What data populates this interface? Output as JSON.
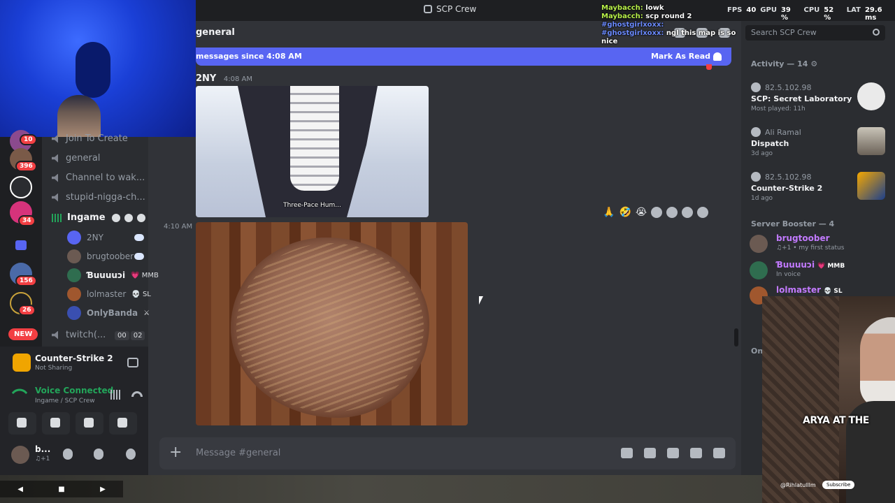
{
  "window": {
    "title": "SCP Crew"
  },
  "perf": {
    "fps_label": "FPS",
    "fps": "40",
    "gpu_label": "GPU",
    "gpu": "39 %",
    "cpu_label": "CPU",
    "cpu": "52 %",
    "lat_label": "LAT",
    "lat": "29.6 ms"
  },
  "server_rail": {
    "badges": [
      "10",
      "396",
      "34",
      "156",
      "26"
    ],
    "new_label": "NEW"
  },
  "channels": {
    "items": [
      "Join To Create",
      "general",
      "Channel to wak...",
      "stupid-nigga-ch...",
      "Ingame",
      "twitch(..."
    ],
    "voice_users": [
      {
        "name": "2NY",
        "tag": ""
      },
      {
        "name": "brugtoober",
        "tag": ""
      },
      {
        "name": "Ɓuuuuɔi",
        "tag": "💗 MMB"
      },
      {
        "name": "lolmaster",
        "tag": "💀 SL"
      },
      {
        "name": "OnlyBanda",
        "tag": "⚔"
      }
    ],
    "twitch_counts": [
      "00",
      "02"
    ]
  },
  "activity": {
    "game": "Counter-Strike 2",
    "status": "Not Sharing"
  },
  "voice": {
    "status": "Voice Connected",
    "location": "Ingame / SCP Crew"
  },
  "user": {
    "name": "b...",
    "status": "♫+1"
  },
  "chat": {
    "channel_title": "general",
    "new_messages": "messages since 4:08 AM",
    "mark_as_read": "Mark As Read",
    "new_tag": "NEW",
    "author": "2NY",
    "time1": "4:08 AM",
    "image1_caption": "Three-Pace Hum...",
    "time2": "4:10 AM",
    "reactions": [
      "🙏",
      "🤣",
      "😭"
    ],
    "composer_placeholder": "Message #general"
  },
  "overlay_chat": [
    {
      "user": "Maybacch:",
      "text": "lowk",
      "color": "green"
    },
    {
      "user": "Maybacch:",
      "text": "scp round 2",
      "color": "green"
    },
    {
      "user": "#ghostgirlxoxx:",
      "text": "",
      "color": "blue"
    },
    {
      "user": "#ghostgirlxoxx:",
      "text": "ngl this map is so nice",
      "color": "blue"
    }
  ],
  "sidebar": {
    "search_placeholder": "Search SCP Crew",
    "activity_header": "Activity — 14",
    "cards": [
      {
        "top": "82.5.102.98",
        "game": "SCP: Secret Laboratory",
        "ago": "Most played: 11h"
      },
      {
        "top": "Ali Ramal",
        "game": "Dispatch",
        "ago": "3d ago"
      },
      {
        "top": "82.5.102.98",
        "game": "Counter-Strike 2",
        "ago": "1d ago"
      }
    ],
    "booster_header": "Server Booster — 4",
    "members": [
      {
        "name": "brugtoober",
        "tag": "",
        "status": "♫+1 • my first status"
      },
      {
        "name": "Ɓuuuuɔi",
        "tag": "💗 MMB",
        "status": "In voice"
      },
      {
        "name": "lolmaster",
        "tag": "💀 SL",
        "status": ""
      }
    ],
    "online_header": "Onl"
  },
  "facecam": {
    "caption": "ARYA AT THE",
    "handle": "@Rihlatulllm",
    "subscribe": "Subscribe"
  }
}
